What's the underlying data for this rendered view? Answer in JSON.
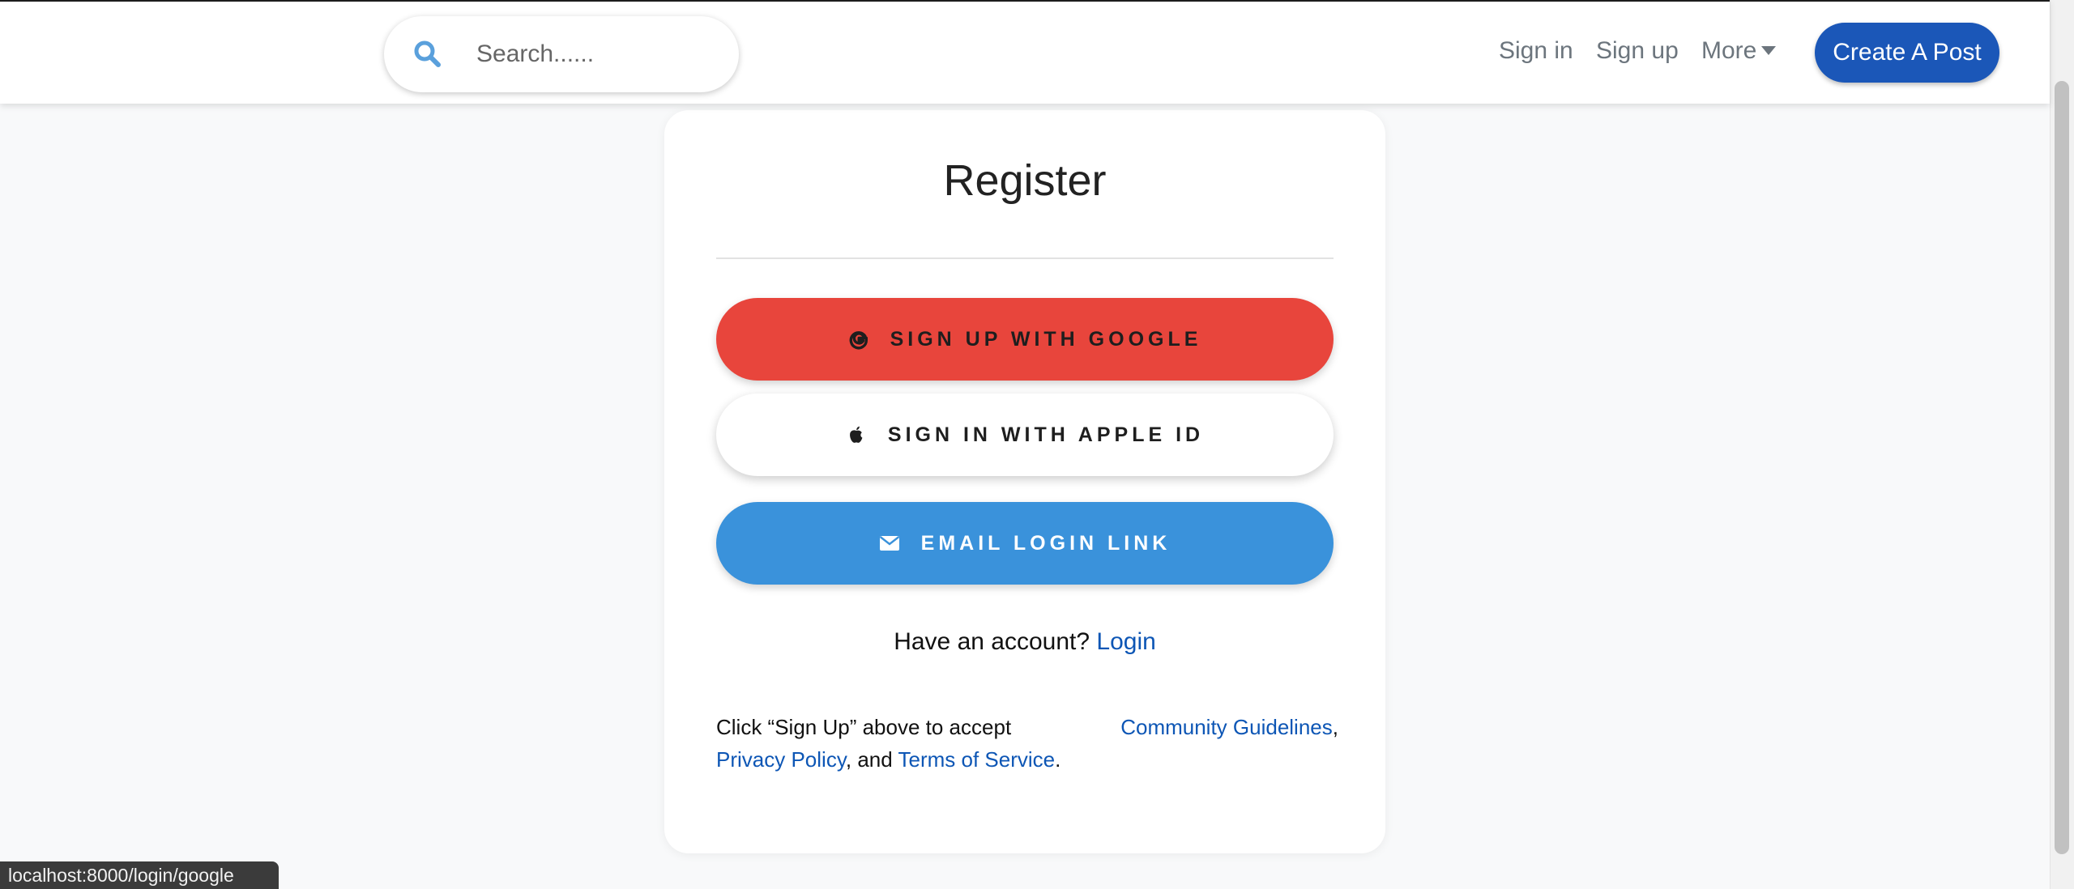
{
  "header": {
    "search": {
      "placeholder": "Search......",
      "value": ""
    },
    "nav": {
      "sign_in": "Sign in",
      "sign_up": "Sign up",
      "more": "More"
    },
    "create_post_label": "Create A Post"
  },
  "register_card": {
    "title": "Register",
    "buttons": {
      "google": "SIGN UP WITH GOOGLE",
      "apple": "SIGN IN WITH APPLE ID",
      "email": "EMAIL LOGIN LINK"
    },
    "have_account": {
      "text": "Have an account?",
      "link": "Login"
    },
    "terms": {
      "prefix": "Click “Sign Up” above to accept",
      "community_guidelines": "Community Guidelines",
      "comma": ",",
      "privacy_policy": "Privacy Policy",
      "and": ", and ",
      "terms_of_service": "Terms of Service",
      "period": "."
    }
  },
  "status_bar": {
    "url": "localhost:8000/login/google"
  },
  "colors": {
    "google_button": "#e8453c",
    "email_button": "#3a92db",
    "create_button": "#1b57b8",
    "link": "#0d56b5",
    "search_icon": "#5aa0dc"
  },
  "icons": {
    "search": "search-icon",
    "more_caret": "caret-down-icon",
    "google": "google-icon",
    "apple": "apple-icon",
    "email": "envelope-icon"
  }
}
